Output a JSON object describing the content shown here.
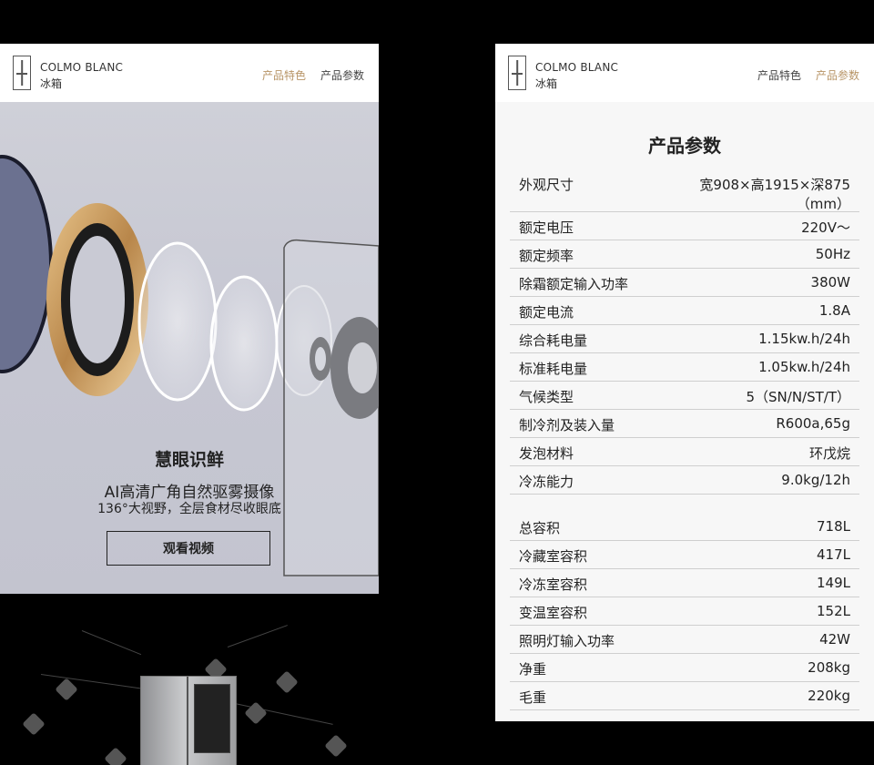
{
  "brand": {
    "name": "COLMO BLANC",
    "sub": "冰箱"
  },
  "nav": {
    "features": "产品特色",
    "params": "产品参数"
  },
  "hero": {
    "title": "慧眼识鲜",
    "subtitle": "AI高清广角自然驱雾摄像",
    "desc": "136°大视野，全层食材尽收眼底",
    "button": "观看视频"
  },
  "specs": {
    "title": "产品参数",
    "group1": [
      {
        "k": "外观尺寸",
        "v": "宽908×高1915×深875（mm）"
      },
      {
        "k": "额定电压",
        "v": "220V～"
      },
      {
        "k": "额定频率",
        "v": "50Hz"
      },
      {
        "k": "除霜额定输入功率",
        "v": "380W"
      },
      {
        "k": "额定电流",
        "v": "1.8A"
      },
      {
        "k": "综合耗电量",
        "v": "1.15kw.h/24h"
      },
      {
        "k": "标准耗电量",
        "v": "1.05kw.h/24h"
      },
      {
        "k": "气候类型",
        "v": "5（SN/N/ST/T）"
      },
      {
        "k": "制冷剂及装入量",
        "v": "R600a,65g"
      },
      {
        "k": "发泡材料",
        "v": "环戊烷"
      },
      {
        "k": "冷冻能力",
        "v": "9.0kg/12h"
      }
    ],
    "group2": [
      {
        "k": "总容积",
        "v": "718L"
      },
      {
        "k": "冷藏室容积",
        "v": "417L"
      },
      {
        "k": "冷冻室容积",
        "v": "149L"
      },
      {
        "k": "变温室容积",
        "v": "152L"
      },
      {
        "k": "照明灯输入功率",
        "v": "42W"
      },
      {
        "k": "净重",
        "v": "208kg"
      },
      {
        "k": "毛重",
        "v": "220kg"
      }
    ]
  }
}
